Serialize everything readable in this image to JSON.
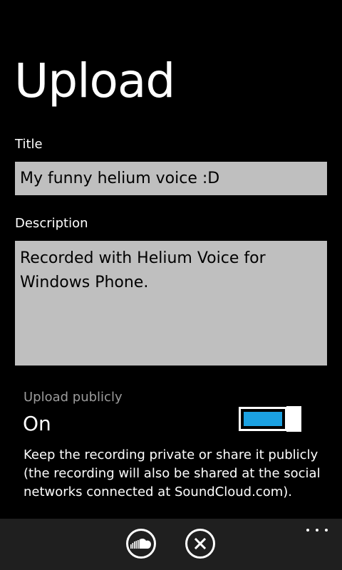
{
  "page": {
    "title": "Upload"
  },
  "form": {
    "title_label": "Title",
    "title_value": "My funny helium voice :D",
    "description_label": "Description",
    "description_value": "Recorded with Helium Voice for Windows Phone."
  },
  "toggle": {
    "header": "Upload publicly",
    "value_label": "On",
    "is_on": true,
    "accent_color": "#1ba1e2"
  },
  "help_text": "Keep the recording private or share it publicly (the recording will also be shared at the social networks connected at SoundCloud.com).",
  "app_bar": {
    "buttons": [
      {
        "icon": "soundcloud-icon",
        "action": "upload"
      },
      {
        "icon": "close-icon",
        "action": "cancel"
      }
    ],
    "more_icon": "ellipsis-icon"
  },
  "colors": {
    "background": "#000000",
    "textbox": "#bfbfbf",
    "subtle_text": "#9c9c9c",
    "app_bar": "#1f1f1f"
  }
}
